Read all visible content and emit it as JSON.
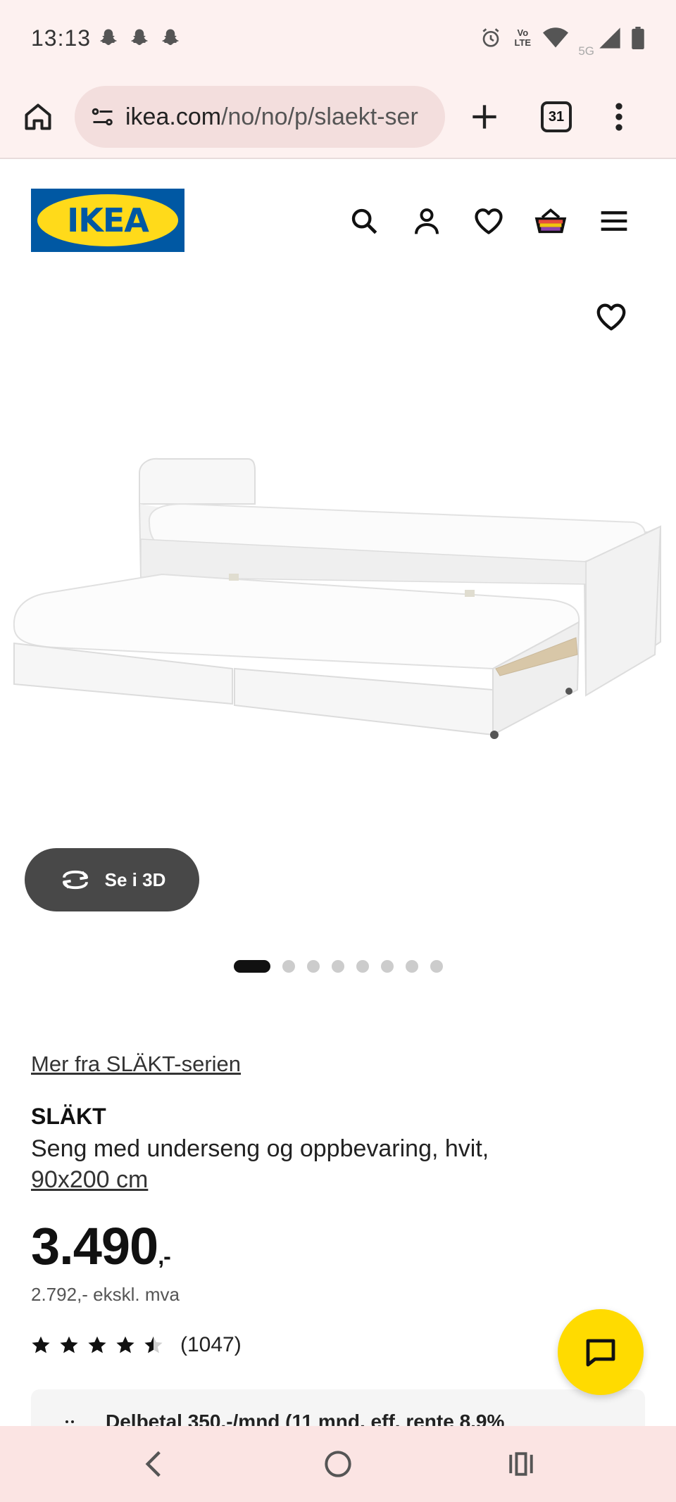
{
  "status_bar": {
    "time": "13:13",
    "network_label": "5G",
    "volte_label": "Vo LTE"
  },
  "browser": {
    "url_host": "ikea.com",
    "url_path": "/no/no/p/slaekt-ser",
    "tab_count": "31"
  },
  "header": {
    "logo_text": "IKEA",
    "icons": [
      "search-icon",
      "account-icon",
      "heart-icon",
      "cart-icon",
      "hamburger-menu-icon"
    ]
  },
  "gallery": {
    "view_3d_label": "Se i 3D",
    "dot_count": 8,
    "active_dot": 0
  },
  "product": {
    "series_link": "Mer fra SLÄKT-serien",
    "name": "SLÄKT",
    "description": "Seng med underseng og oppbevaring, hvit,",
    "size": "90x200 cm",
    "price_main": "3.490",
    "price_suffix": ",-",
    "price_ex_vat": "2.792,- ekskl. mva",
    "rating": 4.5,
    "rating_max": 5,
    "review_count": "(1047)",
    "installment_text": "Delbetal 350,-/mnd (11 mnd, eff. rente 8,9%"
  },
  "colors": {
    "ikea_blue": "#0058a3",
    "ikea_yellow": "#ffda1a",
    "chat_yellow": "#ffdb00",
    "button_dark": "#484848"
  }
}
